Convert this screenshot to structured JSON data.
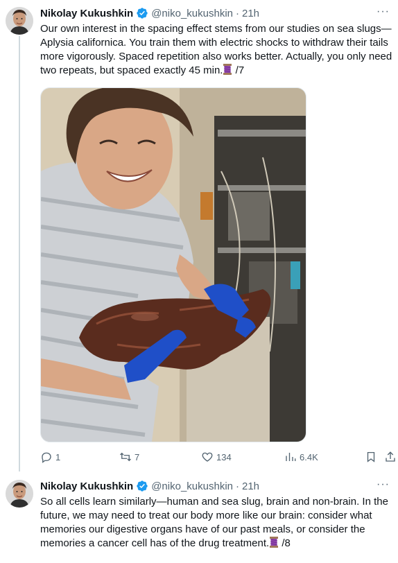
{
  "tweets": [
    {
      "author_name": "Nikolay Kukushkin",
      "handle": "@niko_kukushkin",
      "separator": "·",
      "time": "21h",
      "more": "···",
      "text": "Our own interest in the spacing effect stems from our studies on sea slugs—Aplysia californica. You train them with electric shocks to withdraw their tails more vigorously. Spaced repetition also works better. Actually, you only need two repeats, but spaced exactly 45 min.",
      "thread_marker": "/7",
      "stats": {
        "replies": "1",
        "retweets": "7",
        "likes": "134",
        "views": "6.4K"
      }
    },
    {
      "author_name": "Nikolay Kukushkin",
      "handle": "@niko_kukushkin",
      "separator": "·",
      "time": "21h",
      "more": "···",
      "text": "So all cells learn similarly—human and sea slug, brain and non-brain. In the future, we may need to treat our body more like our brain: consider what memories our digestive organs have of our past meals, or consider the memories a cancer cell has of the drug treatment.",
      "thread_marker": "/8"
    }
  ],
  "icons": {
    "verified": "verified-badge-icon",
    "thread": "thread-spool-icon",
    "reply": "reply-icon",
    "retweet": "retweet-icon",
    "like": "heart-icon",
    "views": "views-chart-icon",
    "bookmark": "bookmark-icon",
    "share": "share-icon"
  },
  "colors": {
    "verified": "#1d9bf0",
    "text": "#0f1419",
    "secondary": "#536471",
    "thread_line": "#cfd9de",
    "thread_emoji": "#8f44ad"
  }
}
